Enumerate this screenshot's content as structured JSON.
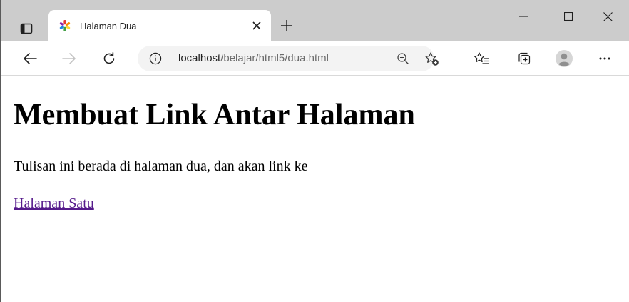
{
  "tab": {
    "title": "Halaman Dua",
    "favicon": "colorful-asterisk-icon"
  },
  "address_bar": {
    "url_host": "localhost",
    "url_path": "/belajar/html5/dua.html"
  },
  "icons": {
    "tab_actions": "tab-actions-icon",
    "close": "close-icon",
    "new_tab": "plus-icon",
    "minimize": "minimize-icon",
    "maximize": "maximize-icon",
    "window_close": "window-close-icon",
    "back": "arrow-left-icon",
    "forward": "arrow-right-icon",
    "reload": "reload-icon",
    "info": "info-icon",
    "zoom": "zoom-in-icon",
    "add_favorite": "star-add-icon",
    "favorites": "favorites-list-icon",
    "collections": "collections-icon",
    "profile": "profile-avatar-icon",
    "more": "more-dots-icon"
  },
  "colors": {
    "titlebar_bg": "#cccccc",
    "visited_link": "#551a8b",
    "url_host": "#1f1f1f",
    "url_path": "#6b6b6b"
  },
  "page": {
    "heading": "Membuat Link Antar Halaman",
    "paragraph": "Tulisan ini berada di halaman dua, dan akan link ke",
    "link_text": "Halaman Satu"
  }
}
